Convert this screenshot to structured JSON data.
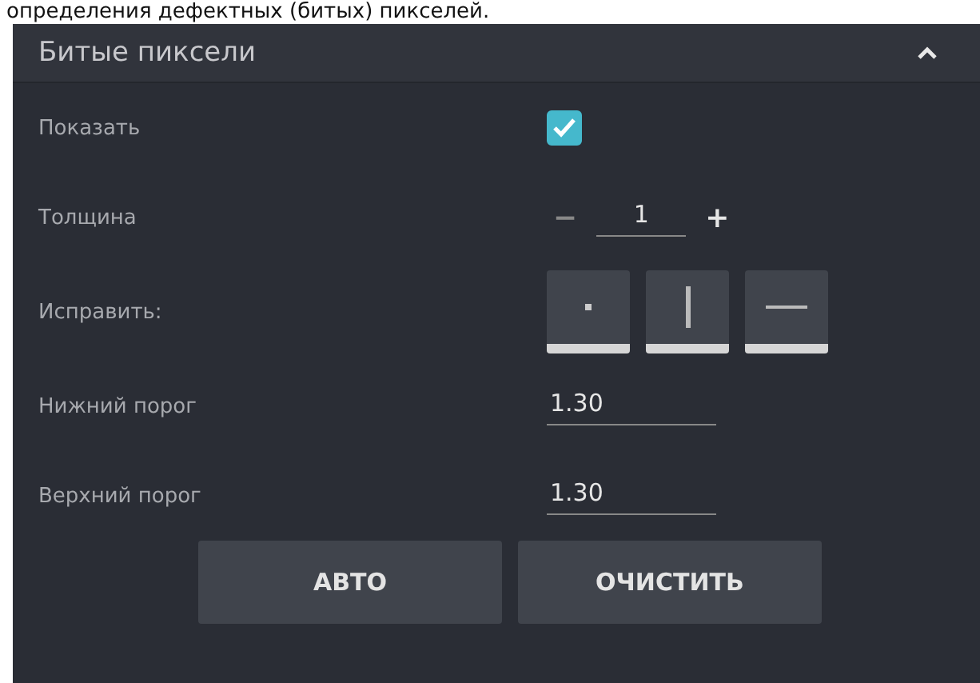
{
  "caption": "определения дефектных (битых) пикселей.",
  "panel": {
    "title": "Битые пиксели",
    "expanded": true
  },
  "show": {
    "label": "Показать",
    "checked": true
  },
  "thickness": {
    "label": "Толщина",
    "minus": "−",
    "value": "1",
    "plus": "+"
  },
  "fix": {
    "label": "Исправить:",
    "tools": [
      {
        "kind": "dot"
      },
      {
        "kind": "vline"
      },
      {
        "kind": "hline"
      }
    ]
  },
  "fields": [
    {
      "label": "Нижний порог",
      "value": "1.30"
    },
    {
      "label": "Верхний порог",
      "value": "1.30"
    }
  ],
  "buttons": [
    "АВТО",
    "ОЧИСТИТЬ"
  ]
}
